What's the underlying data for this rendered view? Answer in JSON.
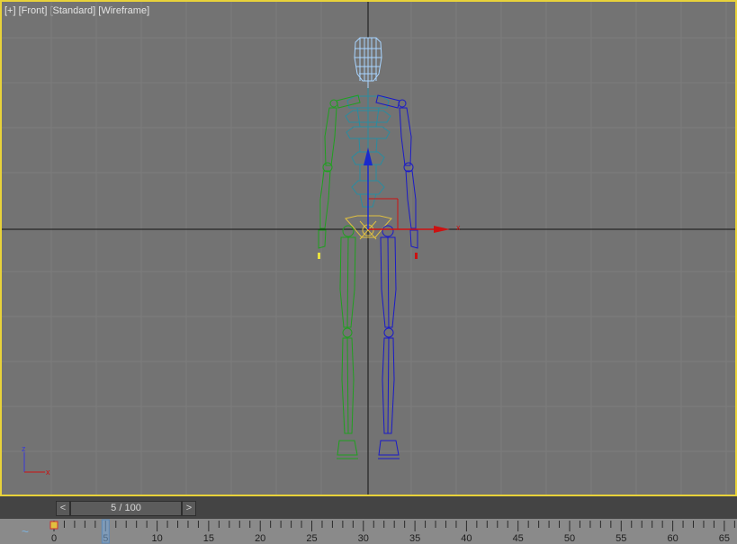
{
  "viewport": {
    "labels": [
      "[+]",
      "[Front]",
      "[Standard]",
      "[Wireframe]"
    ],
    "active_border_color": "#e8d23a",
    "background_color": "#737373",
    "gizmo_axis_label": "x",
    "axis_tripod": {
      "up": "z",
      "right": "x"
    }
  },
  "colors": {
    "left_limb": "#1fa01f",
    "right_limb": "#1a1ac8",
    "spine": "#2a8ca0",
    "head": "#a8d4ff",
    "pelvis": "#e0c040",
    "gizmo_x": "#cc1111",
    "gizmo_y": "#1a2acc"
  },
  "timeline": {
    "prev_label": "<",
    "next_label": ">",
    "slider_text": "5 / 100",
    "current_frame": 5,
    "total_frames": 100,
    "tick_labels": [
      "0",
      "5",
      "10",
      "15",
      "20",
      "25",
      "30",
      "35",
      "40",
      "45",
      "50",
      "55",
      "60",
      "65"
    ],
    "curve_icon": "~"
  }
}
